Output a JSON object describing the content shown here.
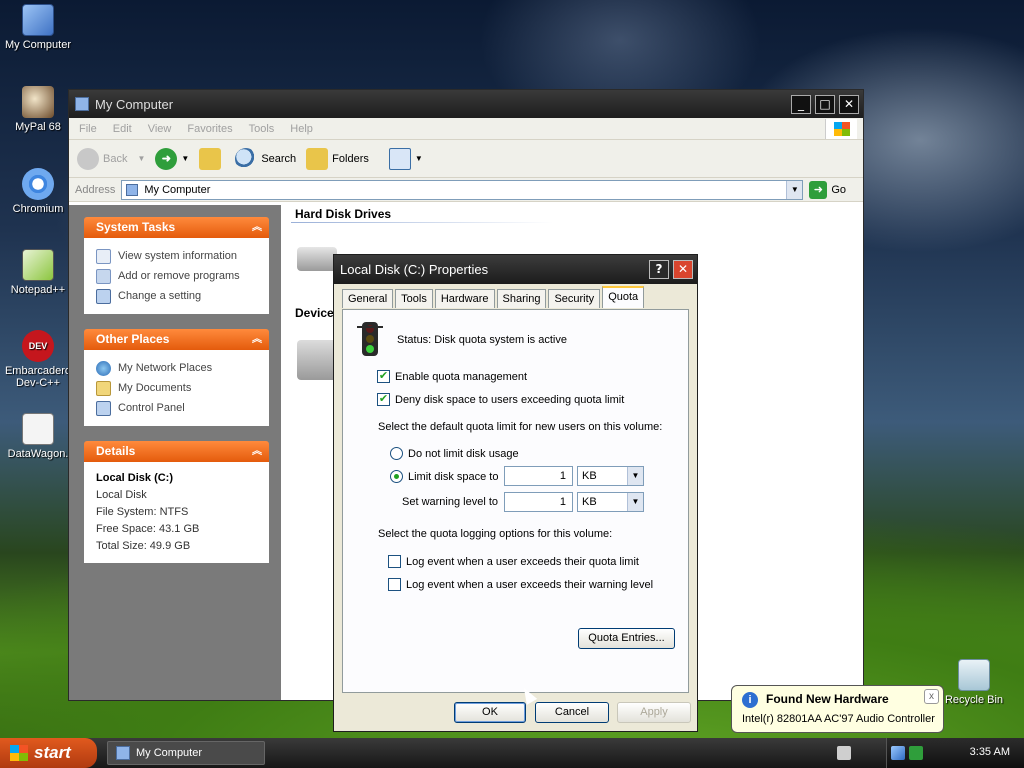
{
  "desktop": {
    "icons": [
      {
        "label": "My Computer",
        "icon": "my-computer-icon"
      },
      {
        "label": "MyPal 68",
        "icon": "mypal-icon"
      },
      {
        "label": "Chromium",
        "icon": "chromium-icon"
      },
      {
        "label": "Notepad++",
        "icon": "notepad-plus-plus-icon"
      },
      {
        "label": "Embarcadero Dev-C++",
        "icon": "devcpp-icon"
      },
      {
        "label": "DataWagon.",
        "icon": "datawagon-icon"
      },
      {
        "label": "Recycle Bin",
        "icon": "recycle-bin-icon"
      }
    ]
  },
  "explorer": {
    "title": "My Computer",
    "menu": [
      "File",
      "Edit",
      "View",
      "Favorites",
      "Tools",
      "Help"
    ],
    "toolbar": {
      "back": "Back",
      "search": "Search",
      "folders": "Folders"
    },
    "address": {
      "label": "Address",
      "value": "My Computer",
      "go": "Go"
    },
    "system_tasks": {
      "title": "System Tasks",
      "items": [
        "View system information",
        "Add or remove programs",
        "Change a setting"
      ]
    },
    "other_places": {
      "title": "Other Places",
      "items": [
        "My Network Places",
        "My Documents",
        "Control Panel"
      ]
    },
    "details": {
      "title": "Details",
      "name": "Local Disk (C:)",
      "type": "Local Disk",
      "file_system": "File System: NTFS",
      "free_space": "Free Space: 43.1 GB",
      "total_size": "Total Size: 49.9 GB"
    },
    "groups": {
      "hard_disks": "Hard Disk Drives",
      "devices": "Device"
    }
  },
  "dialog": {
    "title": "Local Disk (C:) Properties",
    "help_btn": "?",
    "close_btn": "✕",
    "tabs": [
      "General",
      "Tools",
      "Hardware",
      "Sharing",
      "Security",
      "Quota"
    ],
    "active_tab": "Quota",
    "status": "Status:  Disk quota system is active",
    "enable_quota": {
      "label": "Enable quota management",
      "checked": true
    },
    "deny_space": {
      "label": "Deny disk space to users exceeding quota limit",
      "checked": true
    },
    "default_limit_caption": "Select the default quota limit for new users on this volume:",
    "no_limit": {
      "label": "Do not limit disk usage",
      "selected": false
    },
    "limit": {
      "label": "Limit disk space to",
      "selected": true,
      "value": "1",
      "unit": "KB"
    },
    "warning": {
      "label": "Set warning level to",
      "value": "1",
      "unit": "KB"
    },
    "logging_caption": "Select the quota logging options for this volume:",
    "log_limit": {
      "label": "Log event when a user exceeds their quota limit",
      "checked": false
    },
    "log_warning": {
      "label": "Log event when a user exceeds their warning level",
      "checked": false
    },
    "quota_entries": "Quota Entries...",
    "ok": "OK",
    "cancel": "Cancel",
    "apply": "Apply"
  },
  "balloon": {
    "title": "Found New Hardware",
    "message": "Intel(r) 82801AA AC'97 Audio Controller",
    "close": "x"
  },
  "taskbar": {
    "start": "start",
    "task": "My Computer",
    "clock": "3:35 AM"
  },
  "colors": {
    "panel_header": "#e45b0c",
    "titlebar": "#1e1e1e",
    "tab_highlight": "#ffc83c",
    "check_green": "#21a121"
  }
}
